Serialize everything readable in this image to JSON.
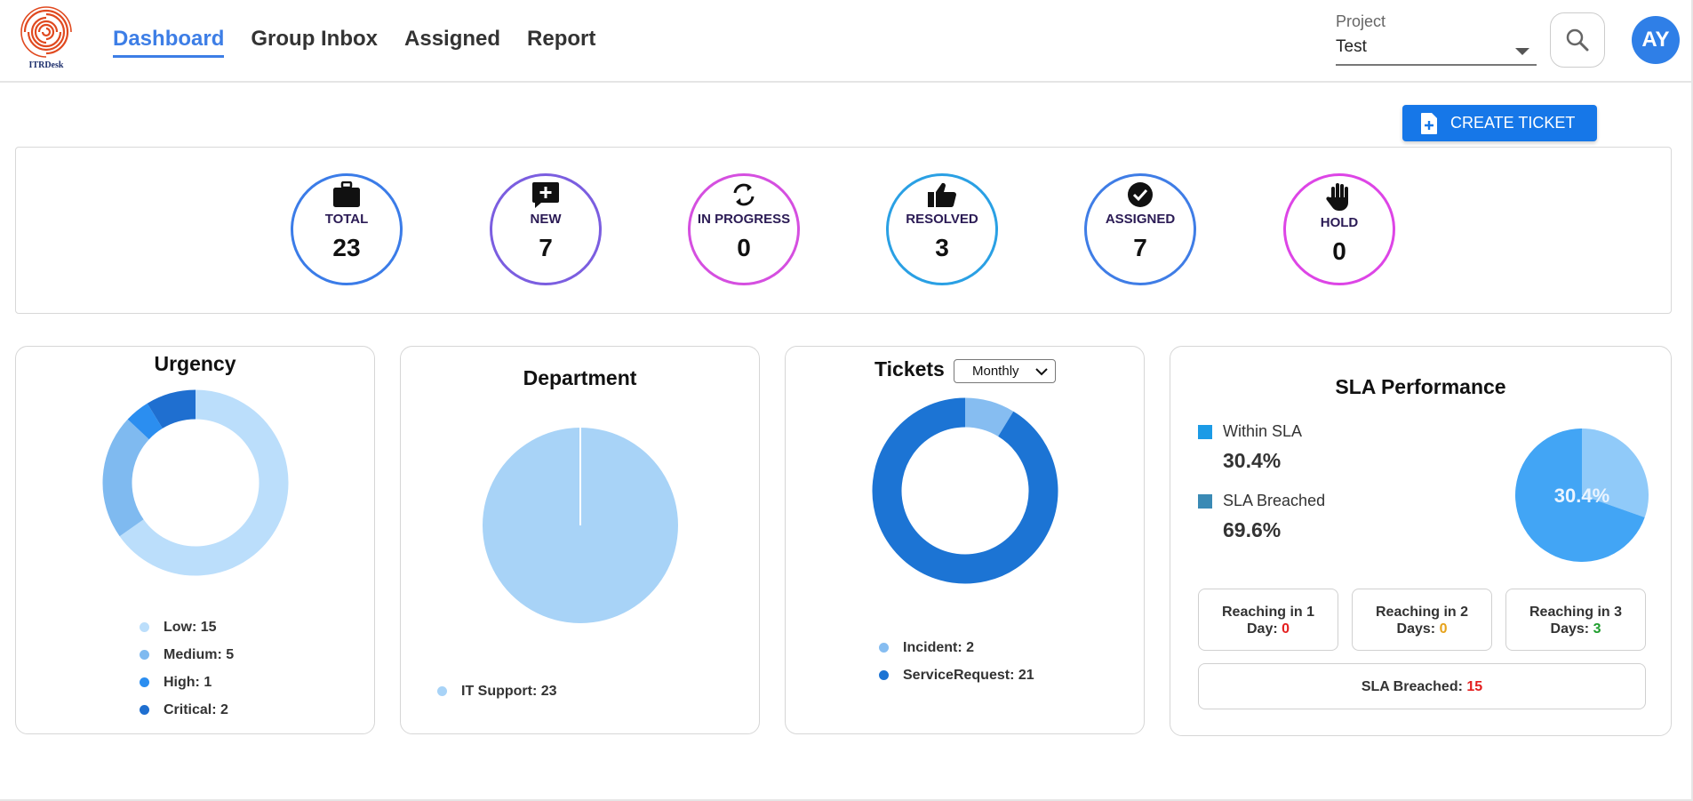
{
  "app": {
    "logo_text": "ITRDesk"
  },
  "nav": {
    "items": [
      {
        "label": "Dashboard",
        "active": true
      },
      {
        "label": "Group Inbox",
        "active": false
      },
      {
        "label": "Assigned",
        "active": false
      },
      {
        "label": "Report",
        "active": false
      }
    ]
  },
  "project": {
    "label": "Project",
    "value": "Test"
  },
  "user": {
    "initials": "AY"
  },
  "actions": {
    "create_ticket": "CREATE TICKET"
  },
  "stats": [
    {
      "label": "TOTAL",
      "value": "23",
      "icon": "briefcase-icon",
      "color": "#3b7ce8"
    },
    {
      "label": "NEW",
      "value": "7",
      "icon": "new-message-icon",
      "color": "#7b5ee0"
    },
    {
      "label": "IN PROGRESS",
      "value": "0",
      "icon": "refresh-icon",
      "color": "#d54fe0"
    },
    {
      "label": "RESOLVED",
      "value": "3",
      "icon": "thumbs-up-icon",
      "color": "#2aa0e4"
    },
    {
      "label": "ASSIGNED",
      "value": "7",
      "icon": "check-circle-icon",
      "color": "#3f7de6"
    },
    {
      "label": "HOLD",
      "value": "0",
      "icon": "hand-icon",
      "color": "#dd45e6"
    }
  ],
  "urgency": {
    "title": "Urgency",
    "legend": [
      {
        "text": "Low: 15",
        "color": "#bbdefb"
      },
      {
        "text": "Medium: 5",
        "color": "#7fbaf0"
      },
      {
        "text": "High: 1",
        "color": "#2b8ef0"
      },
      {
        "text": "Critical: 2",
        "color": "#1f6fd0"
      }
    ]
  },
  "department": {
    "title": "Department",
    "legend": [
      {
        "text": "IT Support: 23",
        "color": "#a8d3f7"
      }
    ]
  },
  "tickets": {
    "title": "Tickets",
    "period": "Monthly",
    "legend": [
      {
        "text": "Incident: 2",
        "color": "#86bdf1"
      },
      {
        "text": "ServiceRequest: 21",
        "color": "#1c74d4"
      }
    ]
  },
  "sla": {
    "title": "SLA Performance",
    "within_label": "Within SLA",
    "within_pct": "30.4%",
    "within_color": "#1c9be6",
    "breached_label": "SLA Breached",
    "breached_pct": "69.6%",
    "breached_color": "#3a8ab5",
    "pie_label": "30.4%",
    "reaching": [
      {
        "line1": "Reaching in 1",
        "line2": "Day: ",
        "value": "0",
        "color": "#e41e1e"
      },
      {
        "line1": "Reaching in 2",
        "line2": "Days: ",
        "value": "0",
        "color": "#e6a21a"
      },
      {
        "line1": "Reaching in 3",
        "line2": "Days: ",
        "value": "3",
        "color": "#1f9e2e"
      }
    ],
    "breached_box": {
      "label": "SLA Breached: ",
      "value": "15",
      "color": "#e41e1e"
    }
  },
  "chart_data": [
    {
      "type": "pie",
      "title": "Urgency",
      "categories": [
        "Low",
        "Medium",
        "High",
        "Critical"
      ],
      "values": [
        15,
        5,
        1,
        2
      ],
      "colors": [
        "#bbdefb",
        "#7fbaf0",
        "#2b8ef0",
        "#1f6fd0"
      ],
      "donut": true
    },
    {
      "type": "pie",
      "title": "Department",
      "categories": [
        "IT Support"
      ],
      "values": [
        23
      ],
      "colors": [
        "#a8d3f7"
      ],
      "donut": false
    },
    {
      "type": "pie",
      "title": "Tickets",
      "categories": [
        "Incident",
        "ServiceRequest"
      ],
      "values": [
        2,
        21
      ],
      "colors": [
        "#86bdf1",
        "#1c74d4"
      ],
      "donut": true
    },
    {
      "type": "pie",
      "title": "SLA Performance",
      "categories": [
        "Within SLA",
        "SLA Breached"
      ],
      "values": [
        30.4,
        69.6
      ],
      "colors": [
        "#90caf9",
        "#42a5f5"
      ],
      "donut": false
    }
  ]
}
